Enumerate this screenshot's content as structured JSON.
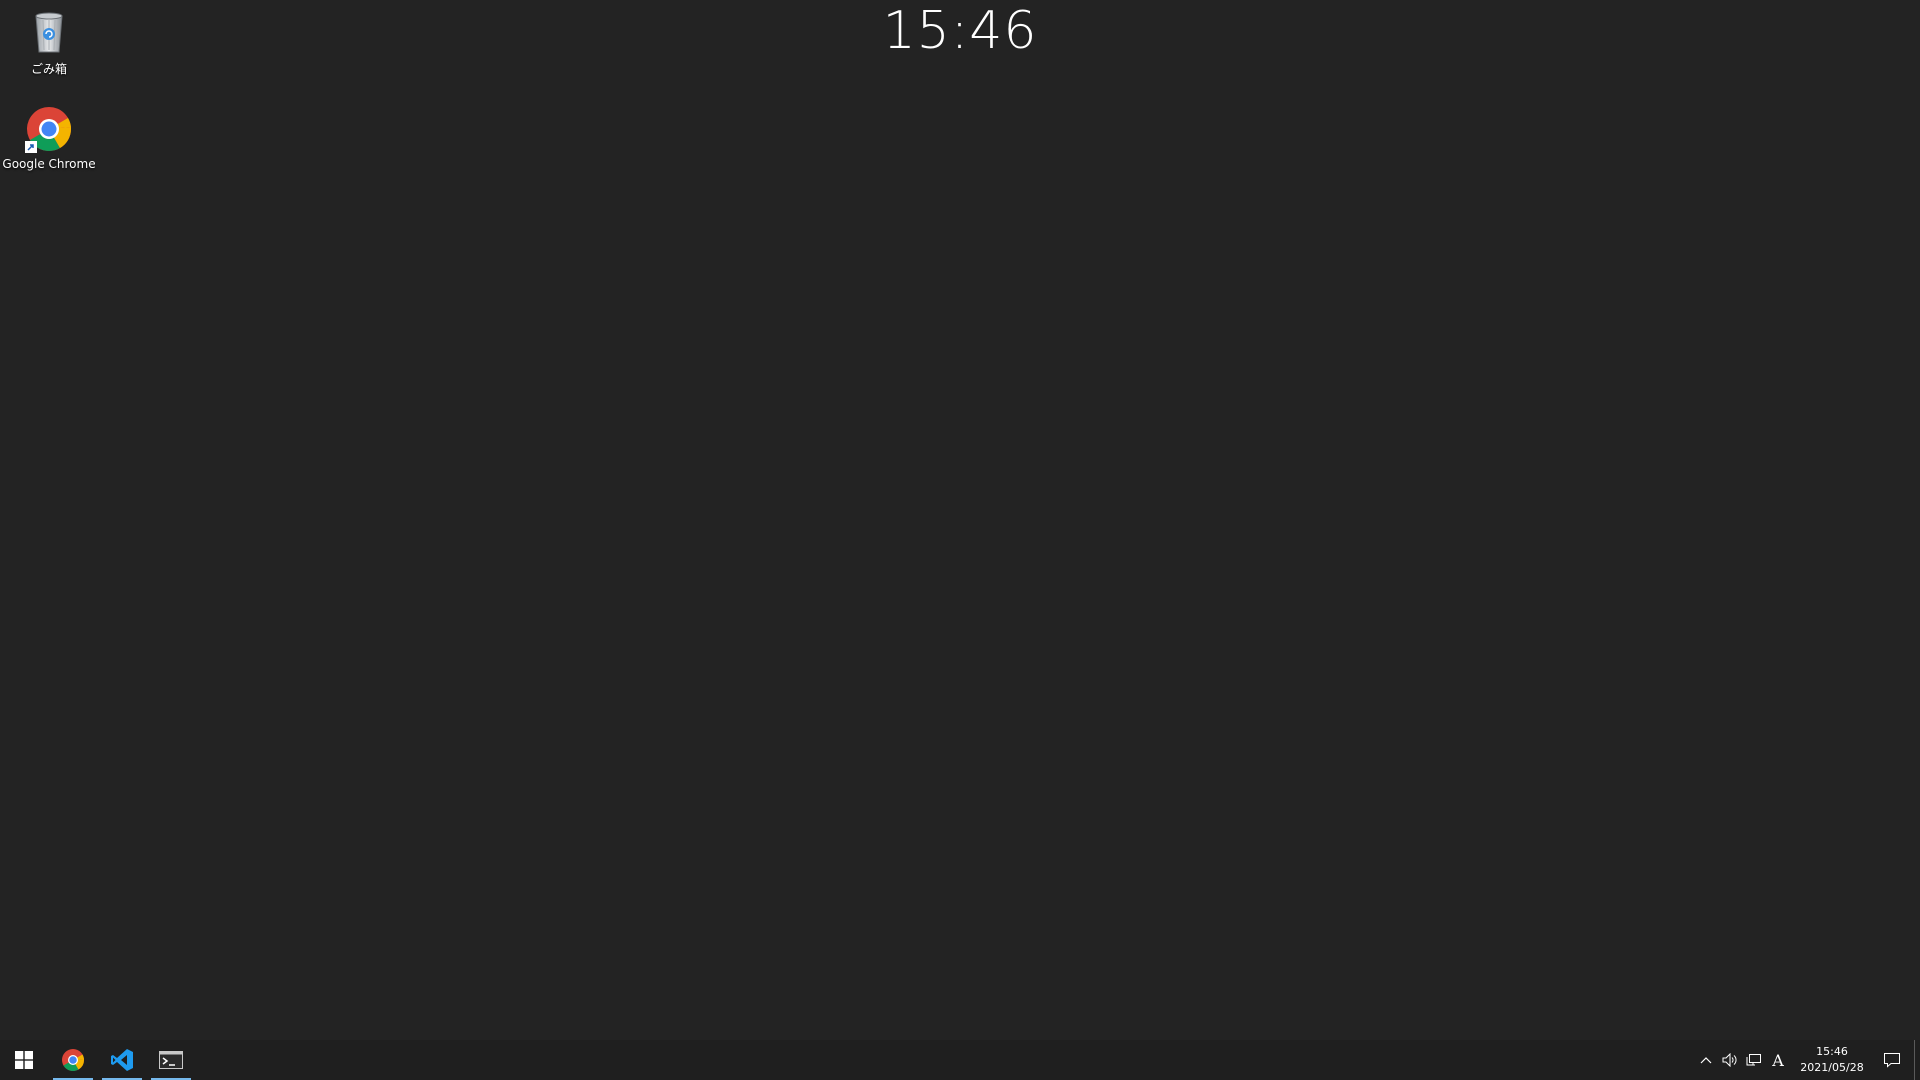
{
  "desktop": {
    "clock": "15:46",
    "icons": [
      {
        "name": "recycle-bin",
        "label": "ごみ箱"
      },
      {
        "name": "google-chrome",
        "label": "Google Chrome"
      }
    ]
  },
  "taskbar": {
    "start_icon": "windows-logo-icon",
    "apps": [
      {
        "name": "chrome",
        "icon": "chrome-icon",
        "running": true
      },
      {
        "name": "vscode",
        "icon": "vscode-icon",
        "running": true
      },
      {
        "name": "terminal",
        "icon": "terminal-icon",
        "running": true
      }
    ],
    "tray": {
      "ime_indicator": "A",
      "time": "15:46",
      "date": "2021/05/28"
    }
  },
  "colors": {
    "desktop_bg": "#232323",
    "taskbar_bg": "#1f1f1f",
    "running_indicator": "#76b9ed",
    "vscode_blue": "#1e9bf0"
  }
}
